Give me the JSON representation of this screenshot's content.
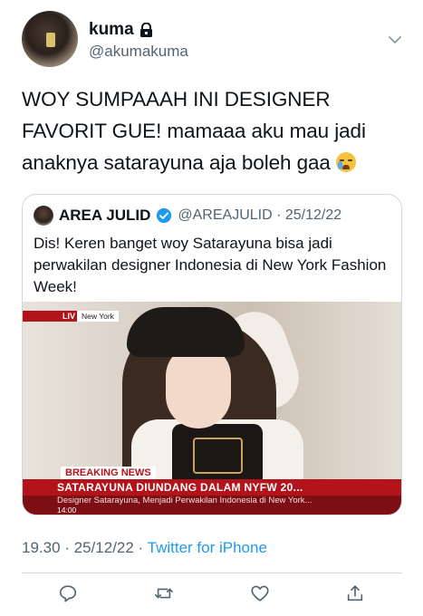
{
  "author": {
    "display_name": "kuma",
    "handle": "@akumakuma",
    "protected": true
  },
  "tweet": {
    "text": "WOY SUMPAAAH INI DESIGNER FAVORIT GUE! mamaaa aku mau jadi anaknya satarayuna aja boleh gaa",
    "emoji": "loudly-crying-face",
    "timestamp": "19.30 · 25/12/22",
    "separator": " · ",
    "client": "Twitter for iPhone"
  },
  "quoted_tweet": {
    "display_name": "AREA JULID",
    "verified": true,
    "handle": "@AREAJULID",
    "date": "25/12/22",
    "meta_separator": " · ",
    "text": "Dis! Keren banget woy Satarayuna bisa jadi perwakilan designer Indonesia di New York Fashion Week!",
    "media": {
      "live_label": "LIV",
      "location": "New York",
      "breaking_label": "BREAKING NEWS",
      "headline": "SATARAYUNA DIUNDANG DALAM NYFW 20...",
      "subheadline": "Designer Satarayuna, Menjadi Perwakilan Indonesia di New York...",
      "time": "14:00"
    }
  },
  "actions": [
    "reply",
    "retweet",
    "like",
    "share"
  ],
  "colors": {
    "link": "#1d9bf0",
    "secondary_text": "#536471",
    "news_red": "#b3141b",
    "border": "#cfd9de"
  }
}
